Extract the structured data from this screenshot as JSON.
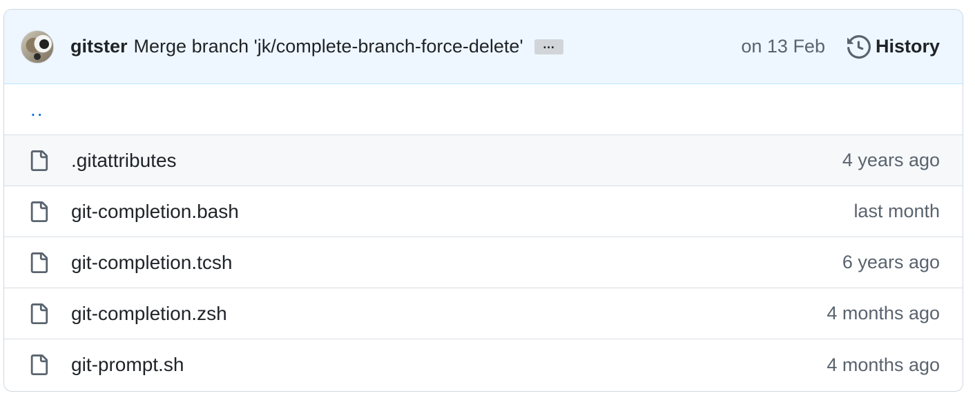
{
  "commit": {
    "author": "gitster",
    "message": "Merge branch 'jk/complete-branch-force-delete'",
    "ellipsis": "…",
    "date": "on 13 Feb",
    "history_label": "History"
  },
  "parent_link": "..",
  "files": [
    {
      "name": ".gitattributes",
      "date": "4 years ago",
      "icon": "file-icon"
    },
    {
      "name": "git-completion.bash",
      "date": "last month",
      "icon": "file-icon"
    },
    {
      "name": "git-completion.tcsh",
      "date": "6 years ago",
      "icon": "file-icon"
    },
    {
      "name": "git-completion.zsh",
      "date": "4 months ago",
      "icon": "file-icon"
    },
    {
      "name": "git-prompt.sh",
      "date": "4 months ago",
      "icon": "file-icon"
    }
  ],
  "colors": {
    "header_bg": "#eef7ff",
    "link": "#0969da",
    "muted": "#59636e",
    "border": "#d0d7de"
  }
}
